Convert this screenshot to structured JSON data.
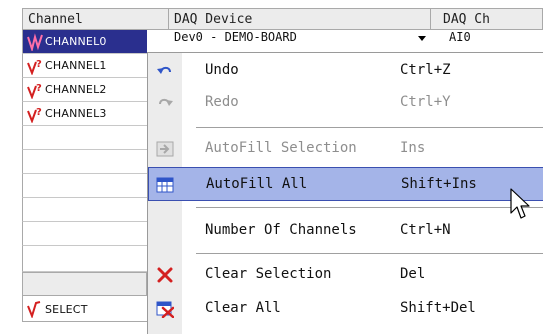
{
  "grid": {
    "headers": [
      "Channel",
      "DAQ Device",
      "DAQ Ch"
    ],
    "rows": [
      {
        "name": "CHANNEL0",
        "selected": true
      },
      {
        "name": "CHANNEL1",
        "selected": false
      },
      {
        "name": "CHANNEL2",
        "selected": false
      },
      {
        "name": "CHANNEL3",
        "selected": false
      }
    ],
    "device_value": "Dev0 - DEMO-BOARD",
    "channel_value": "AI0",
    "select_row": {
      "name": "SELECT"
    }
  },
  "menu": {
    "items": [
      {
        "label": "Undo",
        "shortcut": "Ctrl+Z",
        "icon": "undo-icon",
        "disabled": false
      },
      {
        "label": "Redo",
        "shortcut": "Ctrl+Y",
        "icon": "redo-icon",
        "disabled": true
      },
      {
        "label": "AutoFill Selection",
        "shortcut": "Ins",
        "icon": "autofill-selection-icon",
        "disabled": true
      },
      {
        "label": "AutoFill All",
        "shortcut": "Shift+Ins",
        "icon": "autofill-all-icon",
        "disabled": false,
        "highlighted": true
      },
      {
        "label": "Number Of Channels",
        "shortcut": "Ctrl+N",
        "icon": "",
        "disabled": false
      },
      {
        "label": "Clear Selection",
        "shortcut": "Del",
        "icon": "clear-selection-icon",
        "disabled": false
      },
      {
        "label": "Clear All",
        "shortcut": "Shift+Del",
        "icon": "clear-all-icon",
        "disabled": false
      }
    ]
  },
  "colors": {
    "selection": "#2a2f8e",
    "menu_highlight": "#a4b4e8",
    "menu_highlight_border": "#3a4fb0",
    "disabled_text": "#8e8e8e",
    "delete_red": "#d42020"
  }
}
